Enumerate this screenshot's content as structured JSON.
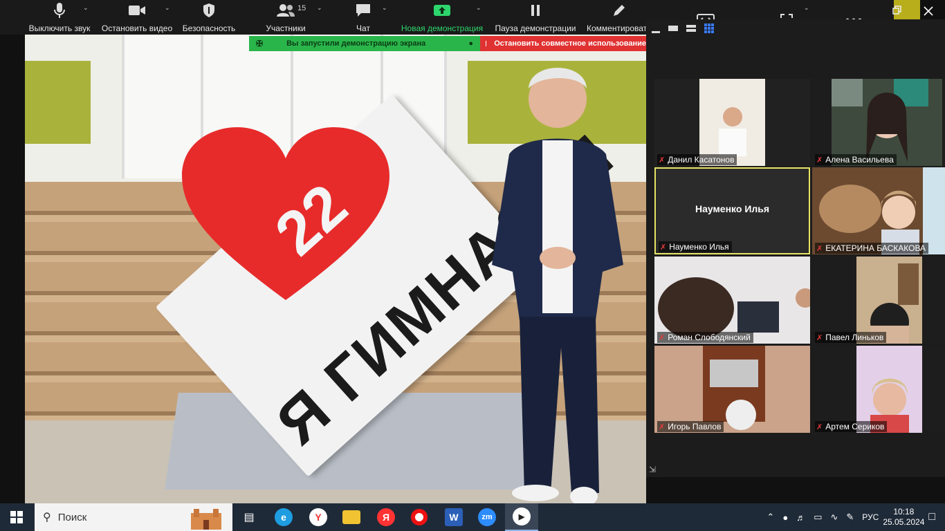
{
  "toolbar": {
    "mute_label": "Выключить звук",
    "video_label": "Остановить видео",
    "security_label": "Безопасность",
    "participants_label": "Участники",
    "participants_count": "15",
    "chat_label": "Чат",
    "new_share_label": "Новая демонстрация",
    "pause_share_label": "Пауза демонстрации",
    "annotate_label": "Комментировать"
  },
  "share_status": {
    "message": "Вы запустили демонстрацию экрана",
    "stop_label": "Остановить совместное использование"
  },
  "shared_content": {
    "sign_text": "Я ГИМНАЗИЯ",
    "heart_number": "22"
  },
  "gallery": {
    "active_speaker": "Науменко Илья",
    "participants": [
      {
        "name": "Данил Касатонов"
      },
      {
        "name": "Алена Васильева"
      },
      {
        "name": "Науменко Илья"
      },
      {
        "name": "ЕКАТЕРИНА БАСКАКОВА"
      },
      {
        "name": "Роман Слободянский"
      },
      {
        "name": "Павел Линьков"
      },
      {
        "name": "Игорь Павлов"
      },
      {
        "name": "Артем Сериков"
      }
    ]
  },
  "taskbar": {
    "search_placeholder": "Поиск",
    "language": "РУС",
    "time": "10:18",
    "date": "25.05.2024"
  },
  "colors": {
    "share_green": "#2ab54b",
    "share_red": "#e03232",
    "active_border": "#e8e466",
    "toolbar_bg": "#1a1a1a",
    "taskbar_bg": "#1f2a38"
  }
}
